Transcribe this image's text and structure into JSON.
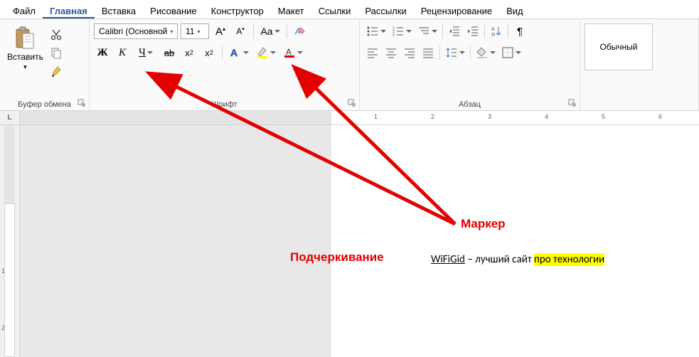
{
  "menu": {
    "items": [
      "Файл",
      "Главная",
      "Вставка",
      "Рисование",
      "Конструктор",
      "Макет",
      "Ссылки",
      "Рассылки",
      "Рецензирование",
      "Вид"
    ],
    "active_index": 1
  },
  "ribbon": {
    "clipboard": {
      "paste_label": "Вставить",
      "group_label": "Буфер обмена"
    },
    "font": {
      "group_label": "Шрифт",
      "font_name": "Calibri (Основной",
      "font_size": "11",
      "bold": "Ж",
      "italic": "К",
      "underline": "Ч",
      "strike": "ab",
      "subscript": "x",
      "superscript": "x",
      "change_case": "Aa"
    },
    "paragraph": {
      "group_label": "Абзац"
    },
    "styles": {
      "normal": "Обычный"
    }
  },
  "ruler": {
    "corner": "L",
    "ticks": [
      "1",
      "2",
      "3",
      "4",
      "5",
      "6"
    ]
  },
  "vruler": {
    "ticks": [
      "1",
      "2"
    ]
  },
  "document": {
    "underlined": "WiFiGid",
    "middle": " – лучший сайт ",
    "highlighted": "про технологии"
  },
  "annotations": {
    "marker": "Маркер",
    "underline": "Подчеркивание"
  }
}
